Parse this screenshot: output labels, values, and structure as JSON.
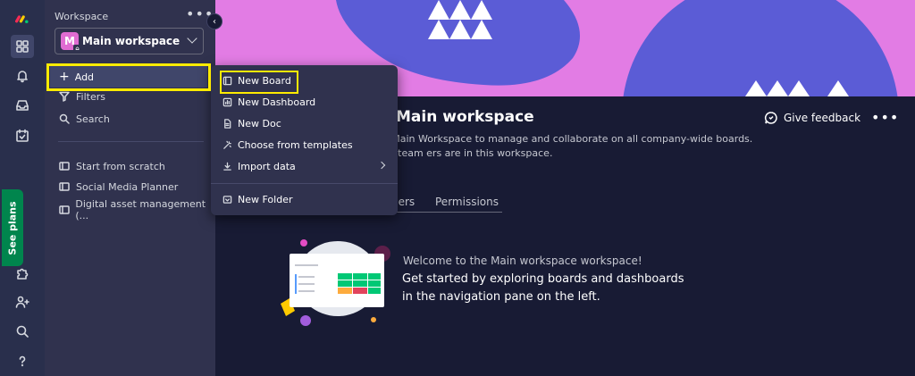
{
  "sidebar": {
    "workspace_label": "Workspace",
    "workspace_initial": "M",
    "workspace_name": "Main workspace",
    "add_label": "Add",
    "filters_label": "Filters",
    "search_label": "Search",
    "boards": [
      {
        "label": "Start from scratch"
      },
      {
        "label": "Social Media Planner"
      },
      {
        "label": "Digital asset management (..."
      }
    ]
  },
  "rail": {
    "see_plans": "See plans"
  },
  "add_menu": {
    "items": [
      {
        "label": "New Board",
        "icon": "board-icon"
      },
      {
        "label": "New Dashboard",
        "icon": "dashboard-icon"
      },
      {
        "label": "New Doc",
        "icon": "doc-icon"
      },
      {
        "label": "Choose from templates",
        "icon": "templates-icon"
      },
      {
        "label": "Import data",
        "icon": "import-icon"
      },
      {
        "label": "New Folder",
        "icon": "folder-icon"
      }
    ]
  },
  "main": {
    "title": "Main workspace",
    "description": "e Main Workspace to manage and collaborate on all company-wide boards. All team ers are in this workspace.",
    "feedback_label": "Give feedback",
    "tabs": [
      {
        "label": "bers"
      },
      {
        "label": "Permissions"
      }
    ],
    "welcome_small": "Welcome to the Main workspace workspace!",
    "welcome_big": "Get started by exploring boards and dashboards in the navigation pane on the left."
  },
  "colors": {
    "banner_pink": "#e27ce4",
    "banner_blue": "#5b5cd6",
    "accent_yellow": "#ffeb00",
    "see_plans_green": "#00854d"
  }
}
